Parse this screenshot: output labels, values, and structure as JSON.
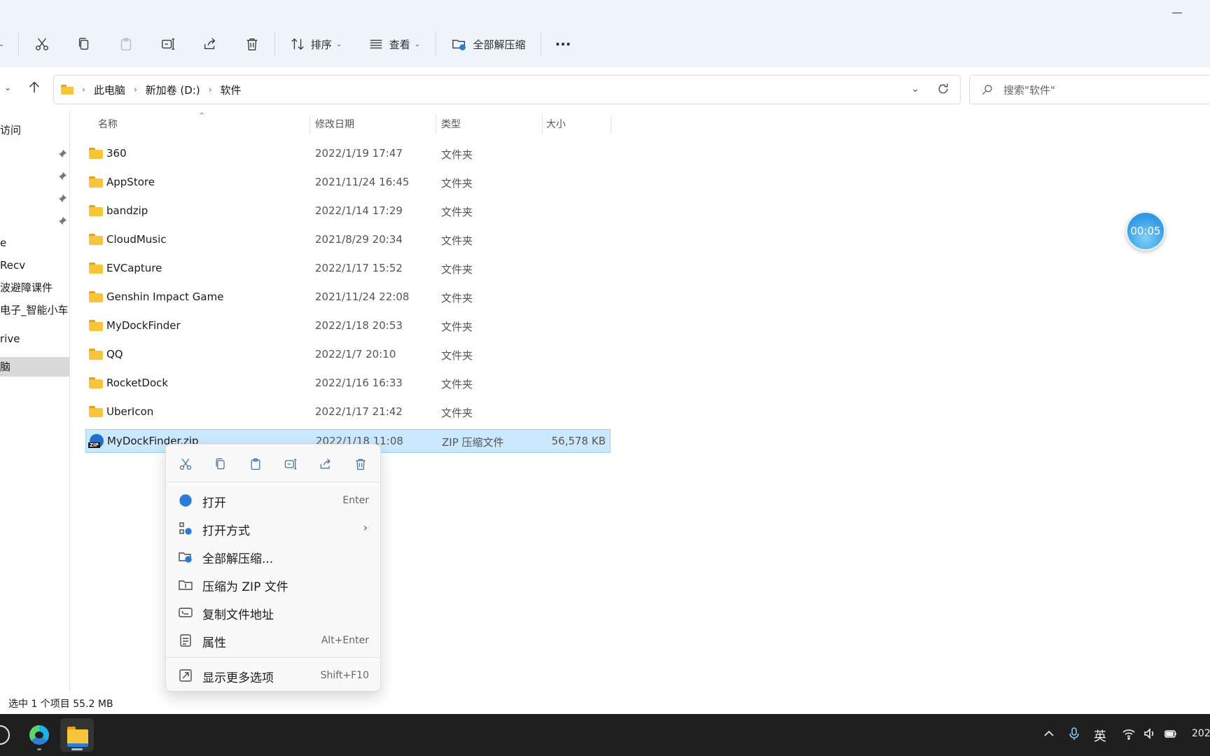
{
  "toolbar": {
    "sort_label": "排序",
    "view_label": "查看",
    "extract_all_label": "全部解压缩",
    "more_label": "···"
  },
  "address": {
    "crumbs": [
      "此电脑",
      "新加卷 (D:)",
      "软件"
    ]
  },
  "search": {
    "placeholder": "搜索\"软件\""
  },
  "sidebar": {
    "items": [
      {
        "label": "访问"
      },
      {
        "label": "e"
      },
      {
        "label": "Recv"
      },
      {
        "label": "波避障课件"
      },
      {
        "label": "电子_智能小车"
      },
      {
        "label": "rive"
      },
      {
        "label": "脑"
      }
    ]
  },
  "columns": {
    "name": "名称",
    "date": "修改日期",
    "type": "类型",
    "size": "大小"
  },
  "files": [
    {
      "name": "360",
      "date": "2022/1/19 17:47",
      "type": "文件夹",
      "size": ""
    },
    {
      "name": "AppStore",
      "date": "2021/11/24 16:45",
      "type": "文件夹",
      "size": ""
    },
    {
      "name": "bandzip",
      "date": "2022/1/14 17:29",
      "type": "文件夹",
      "size": ""
    },
    {
      "name": "CloudMusic",
      "date": "2021/8/29 20:34",
      "type": "文件夹",
      "size": ""
    },
    {
      "name": "EVCapture",
      "date": "2022/1/17 15:52",
      "type": "文件夹",
      "size": ""
    },
    {
      "name": "Genshin Impact Game",
      "date": "2021/11/24 22:08",
      "type": "文件夹",
      "size": ""
    },
    {
      "name": "MyDockFinder",
      "date": "2022/1/18 20:53",
      "type": "文件夹",
      "size": ""
    },
    {
      "name": "QQ",
      "date": "2022/1/7 20:10",
      "type": "文件夹",
      "size": ""
    },
    {
      "name": "RocketDock",
      "date": "2022/1/16 16:33",
      "type": "文件夹",
      "size": ""
    },
    {
      "name": "UberIcon",
      "date": "2022/1/17 21:42",
      "type": "文件夹",
      "size": ""
    },
    {
      "name": "MyDockFinder.zip",
      "date": "2022/1/18 11:08",
      "type": "ZIP 压缩文件",
      "size": "56,578 KB"
    }
  ],
  "context_menu": {
    "items": [
      {
        "label": "打开",
        "shortcut": "Enter"
      },
      {
        "label": "打开方式",
        "shortcut": ""
      },
      {
        "label": "全部解压缩...",
        "shortcut": ""
      },
      {
        "label": "压缩为 ZIP 文件",
        "shortcut": ""
      },
      {
        "label": "复制文件地址",
        "shortcut": ""
      },
      {
        "label": "属性",
        "shortcut": "Alt+Enter"
      },
      {
        "label": "显示更多选项",
        "shortcut": "Shift+F10"
      }
    ]
  },
  "status": {
    "text": "选中 1 个项目  55.2 MB"
  },
  "timer": {
    "text": "00:05"
  },
  "taskbar": {
    "ime": "英",
    "clock": "202"
  },
  "colors": {
    "toolbar_bg": "#eef5f9",
    "selection": "#cce8ff",
    "taskbar": "#1f1f1f"
  }
}
